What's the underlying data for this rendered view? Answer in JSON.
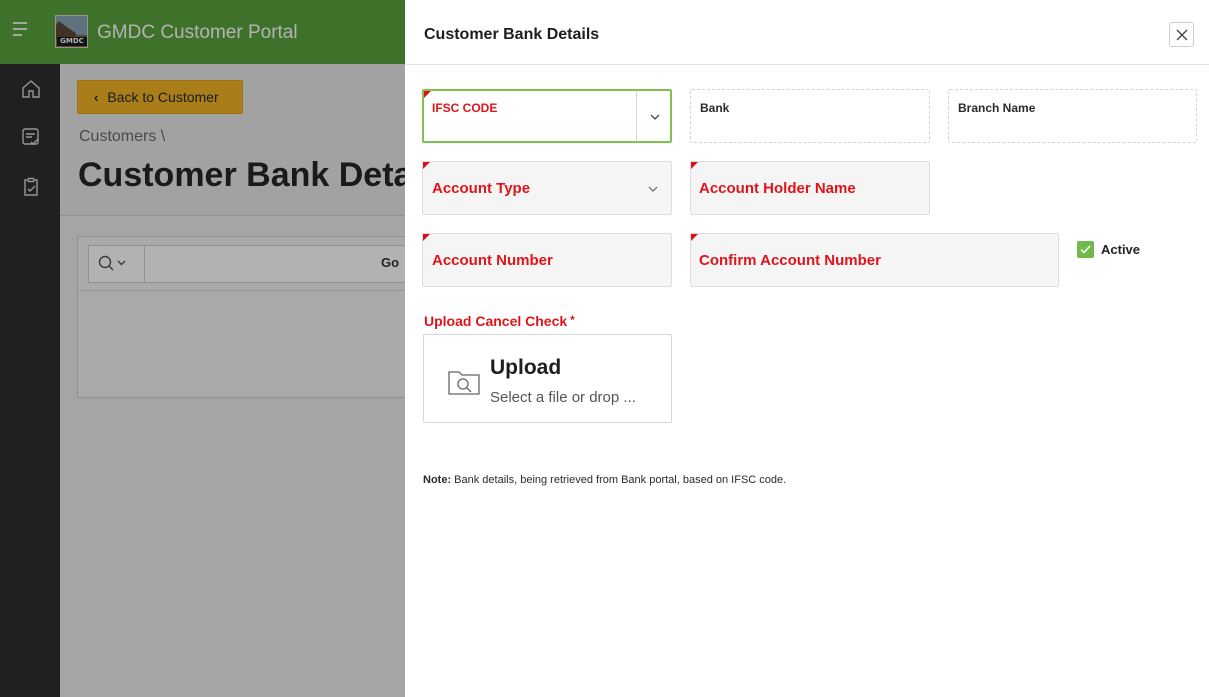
{
  "app": {
    "title": "GMDC Customer Portal",
    "logo_text": "GMDC"
  },
  "background": {
    "back_button": "Back to Customer",
    "breadcrumb": "Customers \\",
    "page_title": "Customer Bank Details",
    "search_go": "Go"
  },
  "drawer": {
    "title": "Customer Bank Details",
    "fields": {
      "ifsc": {
        "label": "IFSC CODE",
        "value": ""
      },
      "bank": {
        "label": "Bank",
        "value": ""
      },
      "branch": {
        "label": "Branch Name",
        "value": ""
      },
      "account_type": {
        "label": "Account Type",
        "value": ""
      },
      "holder_name": {
        "label": "Account Holder Name",
        "value": ""
      },
      "account_number": {
        "label": "Account Number",
        "value": ""
      },
      "confirm_account_number": {
        "label": "Confirm Account Number",
        "value": ""
      }
    },
    "active": {
      "label": "Active",
      "checked": true
    },
    "upload": {
      "label": "Upload Cancel Check",
      "required_marker": "*",
      "title": "Upload",
      "hint": "Select a file or drop ..."
    },
    "note": {
      "prefix": "Note:",
      "text": "Bank details, being retrieved from Bank portal, based on IFSC code."
    }
  },
  "colors": {
    "brand_green": "#5aa33c",
    "required_red": "#e1141a",
    "focus_green": "#7fc24f",
    "button_yellow": "#f2b322"
  }
}
